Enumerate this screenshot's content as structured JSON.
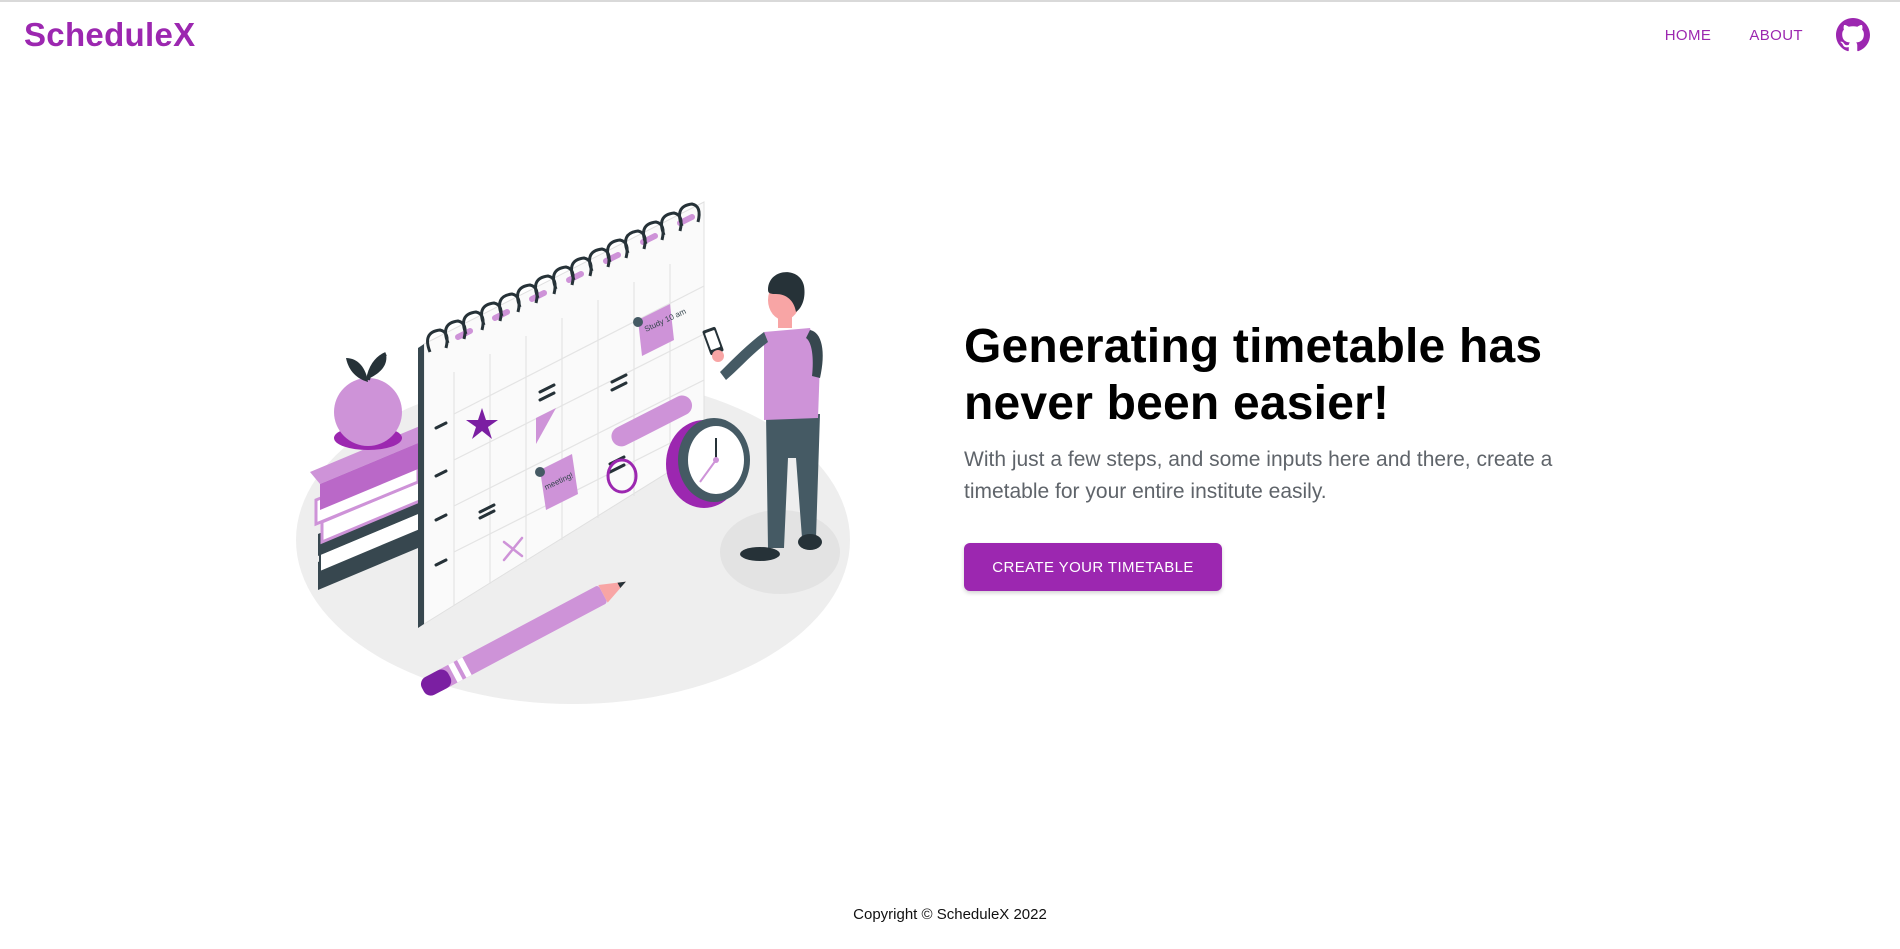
{
  "header": {
    "brand": "ScheduleX",
    "nav": [
      {
        "label": "HOME"
      },
      {
        "label": "ABOUT"
      }
    ],
    "github_icon": "github-icon"
  },
  "hero": {
    "title": "Generating timetable has never been easier!",
    "subtitle": "With just a few steps, and some inputs here and there, create a timetable for your entire institute easily.",
    "cta_label": "CREATE YOUR TIMETABLE",
    "illustration_note_1": "Study 10 am",
    "illustration_note_2": "meeting!"
  },
  "footer": {
    "copyright": "Copyright © ScheduleX 2022"
  },
  "colors": {
    "accent": "#9c27b0",
    "accent_light": "#ce93d8",
    "dark": "#37474f",
    "text_muted": "#5f646a"
  }
}
